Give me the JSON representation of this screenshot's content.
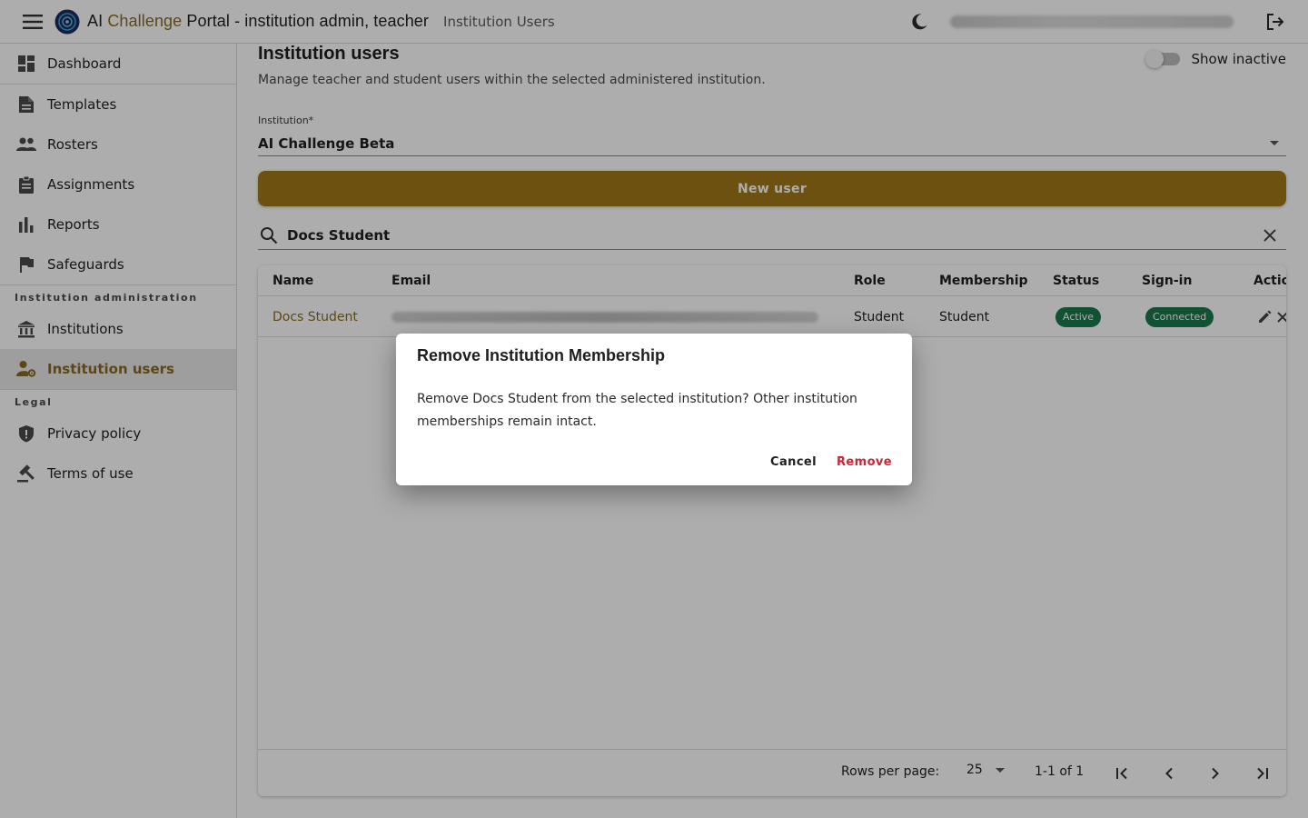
{
  "app": {
    "title_prefix": "AI ",
    "title_accent": "Challenge",
    "title_suffix": " Portal - institution admin, teacher",
    "crumb": "Institution Users"
  },
  "sidebar": {
    "items": [
      {
        "label": "Dashboard",
        "icon": "dashboard-icon"
      },
      {
        "label": "Templates",
        "icon": "document-icon"
      },
      {
        "label": "Rosters",
        "icon": "people-icon"
      },
      {
        "label": "Assignments",
        "icon": "clipboard-icon"
      },
      {
        "label": "Reports",
        "icon": "bar-chart-icon"
      },
      {
        "label": "Safeguards",
        "icon": "flag-icon"
      }
    ],
    "section_admin": "Institution administration",
    "admin_items": [
      {
        "label": "Institutions",
        "icon": "institution-icon"
      },
      {
        "label": "Institution users",
        "icon": "user-gear-icon",
        "active": true
      }
    ],
    "section_legal": "Legal",
    "legal_items": [
      {
        "label": "Privacy policy",
        "icon": "shield-icon"
      },
      {
        "label": "Terms of use",
        "icon": "gavel-icon"
      }
    ]
  },
  "main": {
    "title": "Institution users",
    "subtitle": "Manage teacher and student users within the selected administered institution.",
    "toggle_label": "Show inactive",
    "institution_label": "Institution*",
    "institution_value": "AI Challenge Beta",
    "new_user_label": "New user",
    "search_value": "Docs Student"
  },
  "table": {
    "columns": [
      "Name",
      "Email",
      "Role",
      "Membership",
      "Status",
      "Sign-in",
      "Actio"
    ],
    "rows": [
      {
        "name": "Docs Student",
        "role": "Student",
        "membership": "Student",
        "status": "Active",
        "signin": "Connected"
      }
    ],
    "rows_per_page_label": "Rows per page:",
    "rows_per_page": "25",
    "range": "1-1 of 1"
  },
  "dialog": {
    "title": "Remove Institution Membership",
    "text": "Remove Docs Student from the selected institution? Other institution memberships remain intact.",
    "cancel": "Cancel",
    "remove": "Remove"
  },
  "colors": {
    "accent": "#8a6a1f",
    "button": "#a0781a",
    "chip": "#1a7a4a",
    "danger": "#c62839"
  }
}
